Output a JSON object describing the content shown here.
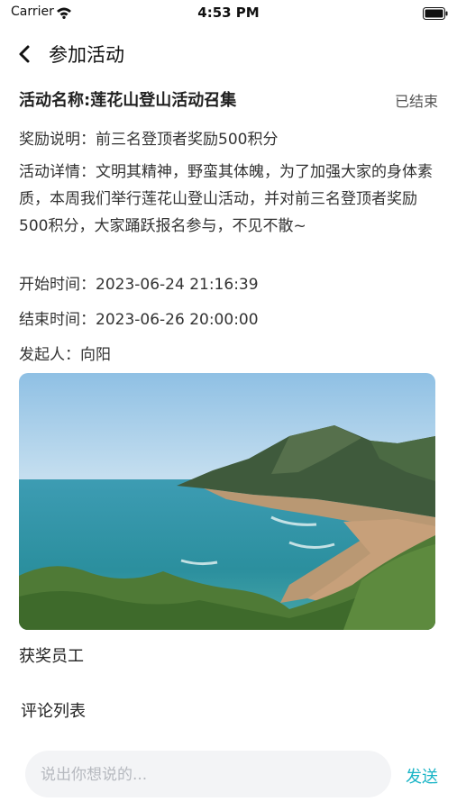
{
  "status_bar": {
    "carrier": "Carrier",
    "time": "4:53 PM"
  },
  "nav": {
    "title": "参加活动",
    "back_icon": "chevron-left-icon"
  },
  "activity": {
    "name": "活动名称:莲花山登山活动召集",
    "status": "已结束",
    "reward": "奖励说明：前三名登顶者奖励500积分",
    "detail": "活动详情：文明其精神，野蛮其体魄，为了加强大家的身体素质，本周我们举行莲花山登山活动，并对前三名登顶者奖励500积分，大家踊跃报名参与，不见不散~",
    "start_time": "开始时间：2023-06-24 21:16:39",
    "end_time": "结束时间：2023-06-26 20:00:00",
    "initiator": "发起人：向阳"
  },
  "sections": {
    "winners": "获奖员工",
    "comments": "评论列表"
  },
  "comment_input": {
    "placeholder": "说出你想说的...",
    "send_label": "发送"
  },
  "colors": {
    "accent": "#19b4c6",
    "input_bg": "#f3f4f6"
  }
}
